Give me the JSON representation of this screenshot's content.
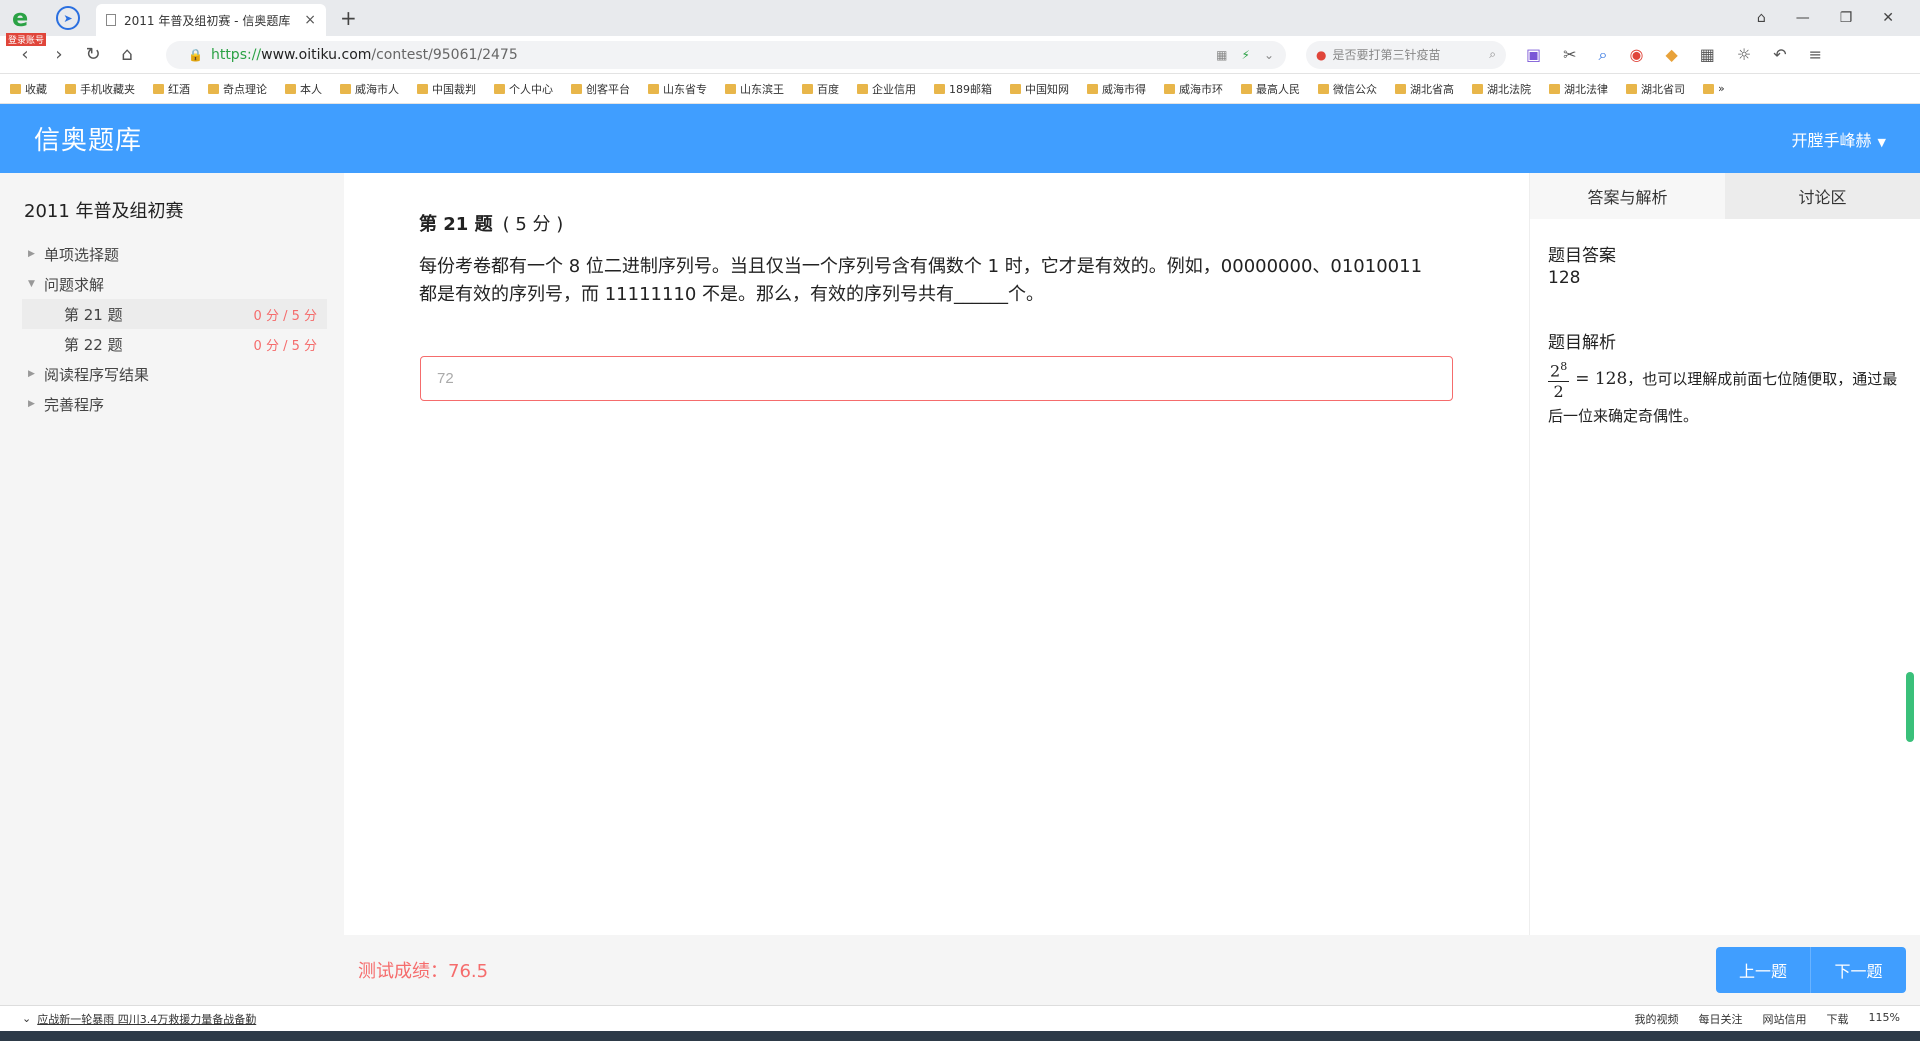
{
  "browser": {
    "login_tag": "登录账号",
    "tab_title": "2011 年普及组初赛 - 信奥题库",
    "tab_close": "×",
    "new_tab": "+",
    "url_https": "https://",
    "url_host": "www.oitiku.com",
    "url_path": "/contest/95061/2475",
    "search_placeholder": "是否要打第三针疫苗",
    "bookmarks": [
      "收藏",
      "手机收藏夹",
      "红酒",
      "奇点理论",
      "本人",
      "威海市人",
      "中国裁判",
      "个人中心",
      "创客平台",
      "山东省专",
      "山东滨王",
      "百度",
      "企业信用",
      "189邮箱",
      "中国知网",
      "威海市得",
      "威海市环",
      "最高人民",
      "微信公众",
      "湖北省高",
      "湖北法院",
      "湖北法律",
      "湖北省司",
      "»"
    ]
  },
  "header": {
    "brand": "信奥题库",
    "user": "开膛手峰赫"
  },
  "sidebar": {
    "contest_title": "2011 年普及组初赛",
    "sections": {
      "s1": "单项选择题",
      "s2": "问题求解",
      "s3": "阅读程序写结果",
      "s4": "完善程序"
    },
    "questions": [
      {
        "label": "第 21 题",
        "score": "0 分 / 5 分"
      },
      {
        "label": "第 22 题",
        "score": "0 分 / 5 分"
      }
    ]
  },
  "question": {
    "title": "第 21 题",
    "points": "( 5 分 )",
    "body_line1": "每份考卷都有一个 8 位二进制序列号。当且仅当一个序列号含有偶数个 1 时，它才是有效的。例如，00000000、01010011",
    "body_line2": "都是有效的序列号，而 11111110 不是。那么，有效的序列号共有______个。",
    "answer_value": "72"
  },
  "right_panel": {
    "tab_answer": "答案与解析",
    "tab_discuss": "讨论区",
    "answer_label": "题目答案",
    "answer_value": "128",
    "analysis_label": "题目解析",
    "frac_num": "2",
    "frac_exp": "8",
    "frac_den": "2",
    "analysis_eq": "= 128",
    "analysis_text": "，也可以理解成前面七位随便取，通过最后一位来确定奇偶性。"
  },
  "footer": {
    "score": "测试成绩：76.5",
    "prev": "上一题",
    "next": "下一题"
  },
  "status_bar": {
    "news": "应战新一轮暴雨 四川3.4万救援力量备战备勤",
    "items": [
      "我的视频",
      "每日关注",
      "网站信用",
      "下载",
      "115%"
    ]
  }
}
